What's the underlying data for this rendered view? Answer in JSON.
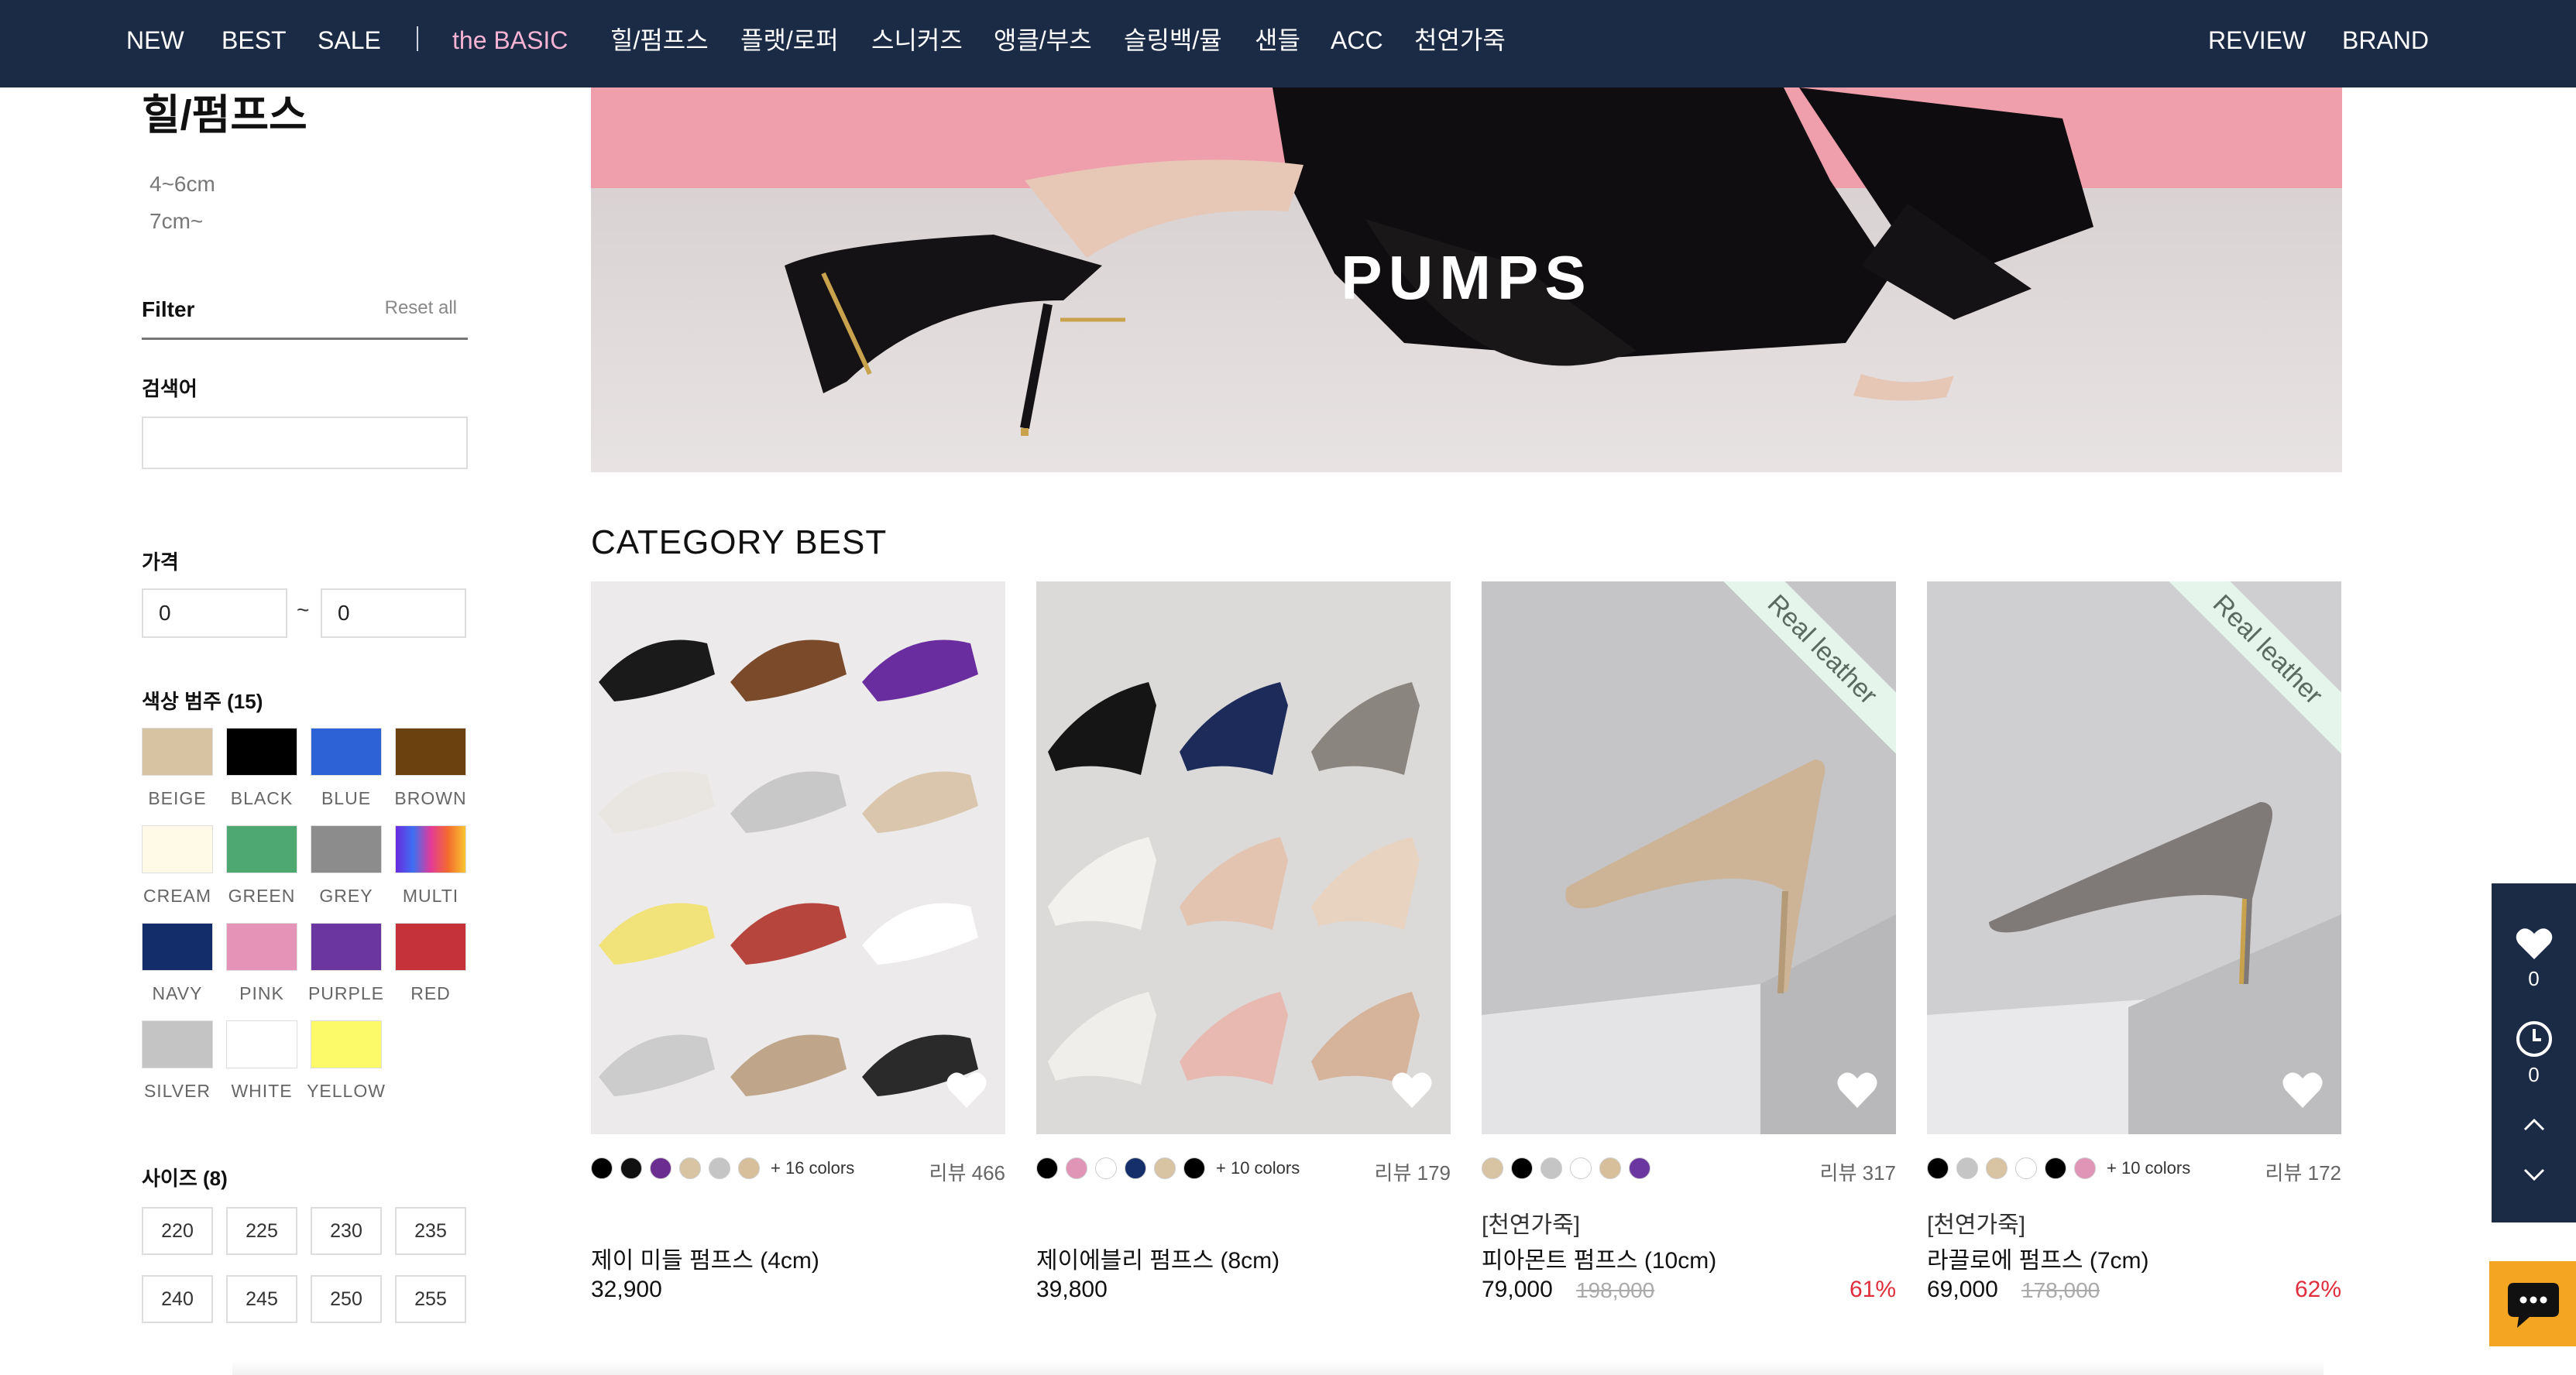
{
  "nav": {
    "left": [
      "NEW",
      "BEST",
      "SALE"
    ],
    "divider": "|",
    "categories": [
      "the BASIC",
      "힐/펌프스",
      "플랫/로퍼",
      "스니커즈",
      "앵클/부츠",
      "슬링백/뮬",
      "샌들",
      "ACC",
      "천연가죽"
    ],
    "right": [
      "REVIEW",
      "BRAND"
    ]
  },
  "sidebar": {
    "title": "힐/펌프스",
    "sub_categories": [
      "4~6cm",
      "7cm~"
    ],
    "filter_label": "Filter",
    "reset_label": "Reset all",
    "search_label": "검색어",
    "search_value": "",
    "price_label": "가격",
    "price_min": "0",
    "price_max": "0",
    "price_sep": "~",
    "color_label": "색상 범주 (15)",
    "colors": [
      {
        "name": "BEIGE",
        "hex": "#d7c3a2"
      },
      {
        "name": "BLACK",
        "hex": "#000000"
      },
      {
        "name": "BLUE",
        "hex": "#2d62d6"
      },
      {
        "name": "BROWN",
        "hex": "#6b420f"
      },
      {
        "name": "CREAM",
        "hex": "#fff9e8"
      },
      {
        "name": "GREEN",
        "hex": "#4da872"
      },
      {
        "name": "GREY",
        "hex": "#8c8c8c"
      },
      {
        "name": "MULTI",
        "hex": "multi"
      },
      {
        "name": "NAVY",
        "hex": "#132d6b"
      },
      {
        "name": "PINK",
        "hex": "#e594b8"
      },
      {
        "name": "PURPLE",
        "hex": "#6b36a0"
      },
      {
        "name": "RED",
        "hex": "#c5323a"
      },
      {
        "name": "SILVER",
        "hex": "#c4c4c4"
      },
      {
        "name": "WHITE",
        "hex": "#ffffff"
      },
      {
        "name": "YELLOW",
        "hex": "#fdfa6a"
      }
    ],
    "size_label": "사이즈 (8)",
    "sizes": [
      "220",
      "225",
      "230",
      "235",
      "240",
      "245",
      "250",
      "255"
    ]
  },
  "banner": {
    "title": "PUMPS"
  },
  "section_title": "CATEGORY BEST",
  "products": [
    {
      "tag": "",
      "name": "제이 미들 펌프스 (4cm)",
      "price": "32,900",
      "original_price": "",
      "discount": "",
      "review": "리뷰 466",
      "more_colors": "+ 16 colors",
      "ribbon": "",
      "dots": [
        "#000000",
        "#111111",
        "#6b2d8f",
        "#d8c3a3",
        "#c5c5c5",
        "#d7bf9c"
      ]
    },
    {
      "tag": "",
      "name": "제이에블리 펌프스 (8cm)",
      "price": "39,800",
      "original_price": "",
      "discount": "",
      "review": "리뷰 179",
      "more_colors": "+ 10 colors",
      "ribbon": "",
      "dots": [
        "#000000",
        "#e094b6",
        "#ffffff",
        "#152f6a",
        "#d8c3a3",
        "#000000"
      ]
    },
    {
      "tag": "[천연가죽]",
      "name": "피아몬트 펌프스 (10cm)",
      "price": "79,000",
      "original_price": "198,000",
      "discount": "61%",
      "review": "리뷰 317",
      "more_colors": "",
      "ribbon": "Real leather",
      "dots": [
        "#d8c3a3",
        "#000000",
        "#c5c5c5",
        "#ffffff",
        "#d7bf9c",
        "#6b36a0"
      ]
    },
    {
      "tag": "[천연가죽]",
      "name": "라끌로에 펌프스 (7cm)",
      "price": "69,000",
      "original_price": "178,000",
      "discount": "62%",
      "review": "리뷰 172",
      "more_colors": "+ 10 colors",
      "ribbon": "Real leather",
      "dots": [
        "#000000",
        "#c5c5c5",
        "#d8c3a3",
        "#ffffff",
        "#000000",
        "#e094b6"
      ]
    }
  ],
  "quick_panel": {
    "wishlist_count": "0",
    "recent_count": "0"
  }
}
